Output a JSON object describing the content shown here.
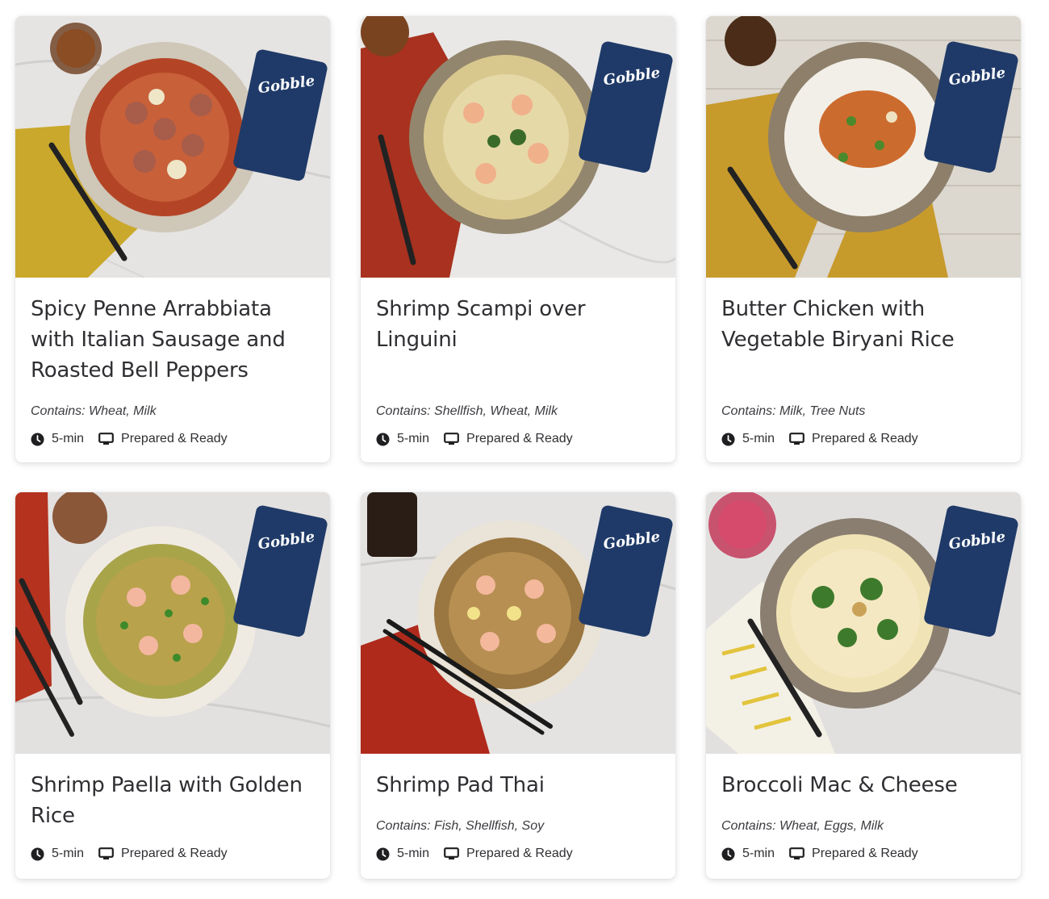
{
  "brand": {
    "logo_text": "Gobble",
    "logo_tagline": "Prepared & Ready",
    "package_color": "#1f3a68"
  },
  "icons": {
    "time": "clock-icon",
    "type": "meal-tray-icon"
  },
  "meals": [
    {
      "title": "Spicy Penne Arrabbiata with Italian Sausage and Roasted Bell Peppers",
      "contains": "Contains: Wheat, Milk",
      "time": "5-min",
      "type": "Prepared & Ready",
      "photo": "plate-penne-sausage"
    },
    {
      "title": "Shrimp Scampi over Linguini",
      "contains": "Contains: Shellfish, Wheat, Milk",
      "time": "5-min",
      "type": "Prepared & Ready",
      "photo": "plate-shrimp-linguini"
    },
    {
      "title": "Butter Chicken with Vegetable Biryani Rice",
      "contains": "Contains: Milk, Tree Nuts",
      "time": "5-min",
      "type": "Prepared & Ready",
      "photo": "plate-butter-chicken"
    },
    {
      "title": "Shrimp Paella with Golden Rice",
      "contains": "",
      "time": "5-min",
      "type": "Prepared & Ready",
      "photo": "bowl-shrimp-paella"
    },
    {
      "title": "Shrimp Pad Thai",
      "contains": "Contains: Fish, Shellfish, Soy",
      "time": "5-min",
      "type": "Prepared & Ready",
      "photo": "bowl-shrimp-pad-thai"
    },
    {
      "title": "Broccoli Mac & Cheese",
      "contains": "Contains: Wheat, Eggs, Milk",
      "time": "5-min",
      "type": "Prepared & Ready",
      "photo": "plate-broccoli-mac"
    }
  ]
}
